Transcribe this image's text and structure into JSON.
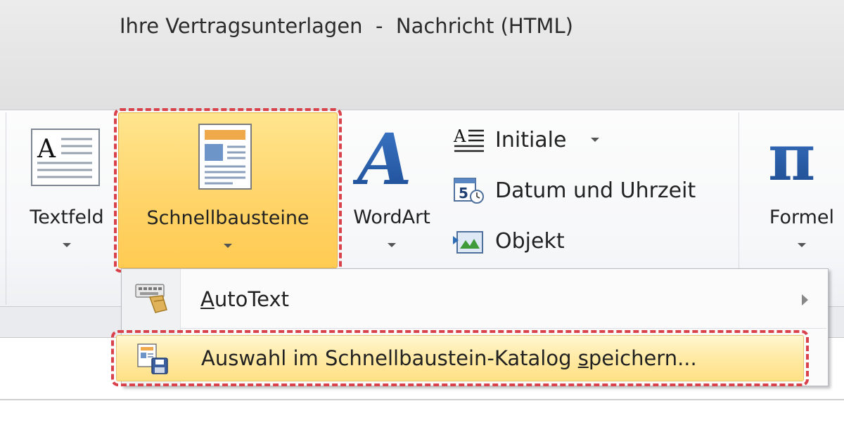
{
  "window": {
    "title": "Ihre Vertragsunterlagen  -  Nachricht (HTML)"
  },
  "ribbon": {
    "buttons": {
      "textfeld": {
        "label": "Textfeld",
        "icon": "textbox-icon"
      },
      "schnellbausteine": {
        "label": "Schnellbausteine",
        "icon": "quick-parts-icon",
        "state": "active"
      },
      "wordart": {
        "label": "WordArt",
        "icon": "wordart-icon"
      },
      "formel": {
        "label": "Formel",
        "icon": "pi-equation-icon"
      }
    },
    "small_buttons": {
      "initiale": {
        "label": "Initiale",
        "icon": "drop-cap-icon"
      },
      "datum": {
        "label": "Datum und Uhrzeit",
        "icon": "date-time-icon"
      },
      "objekt": {
        "label": "Objekt",
        "icon": "object-icon"
      }
    }
  },
  "menu": {
    "autotext": {
      "label_hotkey": "A",
      "label_rest": "utoText",
      "icon": "autotext-icon"
    },
    "save_selection": {
      "label_before": "Auswahl im Schnellbaustein-Katalog ",
      "label_hotkey": "s",
      "label_after": "peichern...",
      "icon": "save-to-gallery-icon"
    }
  },
  "colors": {
    "highlight_outline": "#d9414b",
    "active_button": "#ffd46a",
    "menu_hover": "#ffeaa5"
  }
}
